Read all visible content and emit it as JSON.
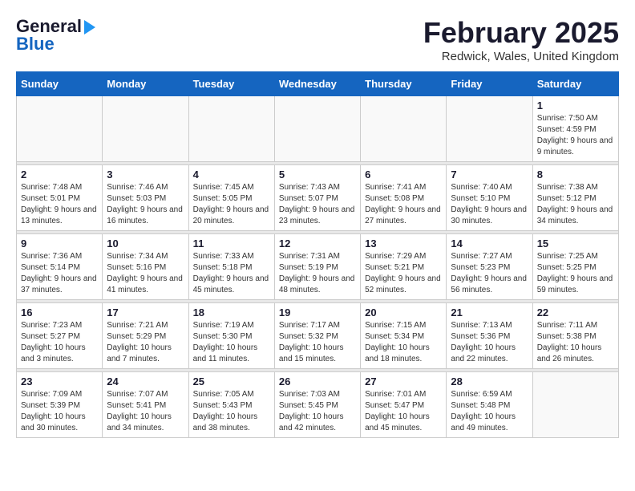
{
  "header": {
    "logo_general": "General",
    "logo_blue": "Blue",
    "month": "February 2025",
    "location": "Redwick, Wales, United Kingdom"
  },
  "days_of_week": [
    "Sunday",
    "Monday",
    "Tuesday",
    "Wednesday",
    "Thursday",
    "Friday",
    "Saturday"
  ],
  "weeks": [
    [
      {
        "day": "",
        "info": ""
      },
      {
        "day": "",
        "info": ""
      },
      {
        "day": "",
        "info": ""
      },
      {
        "day": "",
        "info": ""
      },
      {
        "day": "",
        "info": ""
      },
      {
        "day": "",
        "info": ""
      },
      {
        "day": "1",
        "info": "Sunrise: 7:50 AM\nSunset: 4:59 PM\nDaylight: 9 hours and 9 minutes."
      }
    ],
    [
      {
        "day": "2",
        "info": "Sunrise: 7:48 AM\nSunset: 5:01 PM\nDaylight: 9 hours and 13 minutes."
      },
      {
        "day": "3",
        "info": "Sunrise: 7:46 AM\nSunset: 5:03 PM\nDaylight: 9 hours and 16 minutes."
      },
      {
        "day": "4",
        "info": "Sunrise: 7:45 AM\nSunset: 5:05 PM\nDaylight: 9 hours and 20 minutes."
      },
      {
        "day": "5",
        "info": "Sunrise: 7:43 AM\nSunset: 5:07 PM\nDaylight: 9 hours and 23 minutes."
      },
      {
        "day": "6",
        "info": "Sunrise: 7:41 AM\nSunset: 5:08 PM\nDaylight: 9 hours and 27 minutes."
      },
      {
        "day": "7",
        "info": "Sunrise: 7:40 AM\nSunset: 5:10 PM\nDaylight: 9 hours and 30 minutes."
      },
      {
        "day": "8",
        "info": "Sunrise: 7:38 AM\nSunset: 5:12 PM\nDaylight: 9 hours and 34 minutes."
      }
    ],
    [
      {
        "day": "9",
        "info": "Sunrise: 7:36 AM\nSunset: 5:14 PM\nDaylight: 9 hours and 37 minutes."
      },
      {
        "day": "10",
        "info": "Sunrise: 7:34 AM\nSunset: 5:16 PM\nDaylight: 9 hours and 41 minutes."
      },
      {
        "day": "11",
        "info": "Sunrise: 7:33 AM\nSunset: 5:18 PM\nDaylight: 9 hours and 45 minutes."
      },
      {
        "day": "12",
        "info": "Sunrise: 7:31 AM\nSunset: 5:19 PM\nDaylight: 9 hours and 48 minutes."
      },
      {
        "day": "13",
        "info": "Sunrise: 7:29 AM\nSunset: 5:21 PM\nDaylight: 9 hours and 52 minutes."
      },
      {
        "day": "14",
        "info": "Sunrise: 7:27 AM\nSunset: 5:23 PM\nDaylight: 9 hours and 56 minutes."
      },
      {
        "day": "15",
        "info": "Sunrise: 7:25 AM\nSunset: 5:25 PM\nDaylight: 9 hours and 59 minutes."
      }
    ],
    [
      {
        "day": "16",
        "info": "Sunrise: 7:23 AM\nSunset: 5:27 PM\nDaylight: 10 hours and 3 minutes."
      },
      {
        "day": "17",
        "info": "Sunrise: 7:21 AM\nSunset: 5:29 PM\nDaylight: 10 hours and 7 minutes."
      },
      {
        "day": "18",
        "info": "Sunrise: 7:19 AM\nSunset: 5:30 PM\nDaylight: 10 hours and 11 minutes."
      },
      {
        "day": "19",
        "info": "Sunrise: 7:17 AM\nSunset: 5:32 PM\nDaylight: 10 hours and 15 minutes."
      },
      {
        "day": "20",
        "info": "Sunrise: 7:15 AM\nSunset: 5:34 PM\nDaylight: 10 hours and 18 minutes."
      },
      {
        "day": "21",
        "info": "Sunrise: 7:13 AM\nSunset: 5:36 PM\nDaylight: 10 hours and 22 minutes."
      },
      {
        "day": "22",
        "info": "Sunrise: 7:11 AM\nSunset: 5:38 PM\nDaylight: 10 hours and 26 minutes."
      }
    ],
    [
      {
        "day": "23",
        "info": "Sunrise: 7:09 AM\nSunset: 5:39 PM\nDaylight: 10 hours and 30 minutes."
      },
      {
        "day": "24",
        "info": "Sunrise: 7:07 AM\nSunset: 5:41 PM\nDaylight: 10 hours and 34 minutes."
      },
      {
        "day": "25",
        "info": "Sunrise: 7:05 AM\nSunset: 5:43 PM\nDaylight: 10 hours and 38 minutes."
      },
      {
        "day": "26",
        "info": "Sunrise: 7:03 AM\nSunset: 5:45 PM\nDaylight: 10 hours and 42 minutes."
      },
      {
        "day": "27",
        "info": "Sunrise: 7:01 AM\nSunset: 5:47 PM\nDaylight: 10 hours and 45 minutes."
      },
      {
        "day": "28",
        "info": "Sunrise: 6:59 AM\nSunset: 5:48 PM\nDaylight: 10 hours and 49 minutes."
      },
      {
        "day": "",
        "info": ""
      }
    ]
  ]
}
